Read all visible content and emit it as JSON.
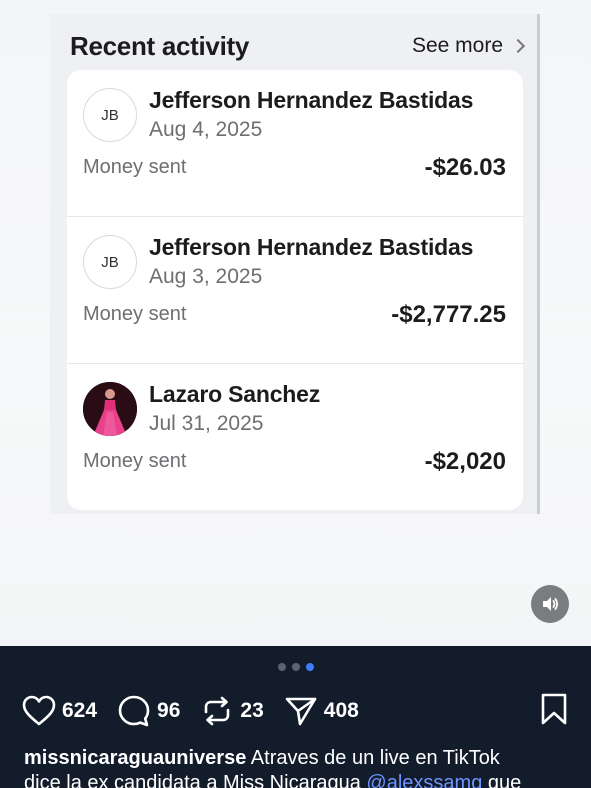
{
  "card": {
    "title": "Recent activity",
    "see_more": "See more",
    "transactions": [
      {
        "initials": "JB",
        "name": "Jefferson Hernandez Bastidas",
        "date": "Aug 4, 2025",
        "kind": "Money sent",
        "amount": "-$26.03",
        "avatar": "initials-avatar"
      },
      {
        "initials": "JB",
        "name": "Jefferson Hernandez Bastidas",
        "date": "Aug 3, 2025",
        "kind": "Money sent",
        "amount": "-$2,777.25",
        "avatar": "initials-avatar"
      },
      {
        "initials": "",
        "name": "Lazaro Sanchez",
        "date": "Jul 31, 2025",
        "kind": "Money sent",
        "amount": "-$2,020",
        "avatar": "photo-avatar-pink-gown"
      }
    ]
  },
  "media": {
    "sound_icon": "speaker-icon"
  },
  "carousel": {
    "total": 3,
    "active_index": 2
  },
  "actions": {
    "likes": "624",
    "comments": "96",
    "reposts": "23",
    "shares": "408",
    "icons": [
      "heart-icon",
      "comment-icon",
      "repost-icon",
      "share-icon",
      "bookmark-icon"
    ]
  },
  "caption": {
    "username": "missnicaraguauniverse",
    "line1": "Atraves de un live en TikTok",
    "line2": "dice la ex candidata a Miss Nicaragua",
    "mention": "@alexssamg",
    "line2_tail": "que"
  },
  "colors": {
    "accent": "#3f7cff",
    "mention": "#6f93ff",
    "bottom_bg": "#121c2b"
  }
}
